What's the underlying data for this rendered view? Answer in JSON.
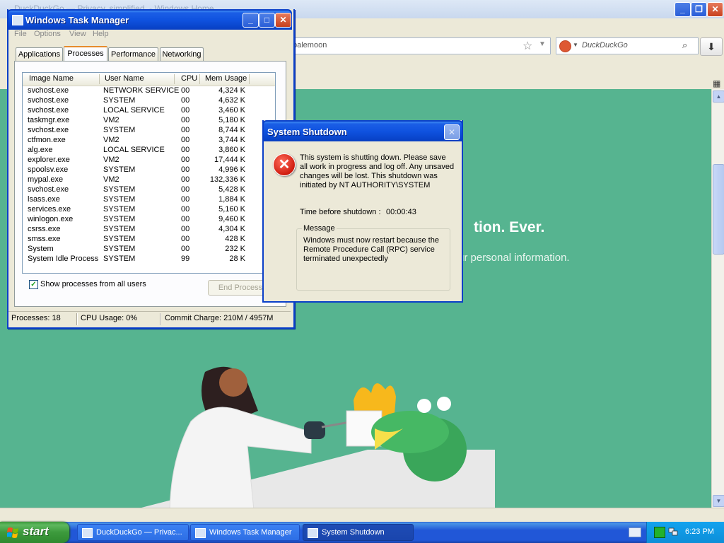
{
  "browser": {
    "title": "DuckDuckGo — Privacy, simplified. - Windows Home",
    "url_value": "palemoon",
    "search_placeholder": "DuckDuckGo",
    "hero_heading": "tion. Ever.",
    "hero_subtext": "ur personal information."
  },
  "taskmgr": {
    "title": "Windows Task Manager",
    "menu": [
      "File",
      "Options",
      "View",
      "Help"
    ],
    "tabs": [
      "Applications",
      "Processes",
      "Performance",
      "Networking"
    ],
    "active_tab": "Processes",
    "columns": [
      "Image Name",
      "User Name",
      "CPU",
      "Mem Usage"
    ],
    "processes": [
      [
        "svchost.exe",
        "NETWORK SERVICE",
        "00",
        "4,324 K"
      ],
      [
        "svchost.exe",
        "SYSTEM",
        "00",
        "4,632 K"
      ],
      [
        "svchost.exe",
        "LOCAL SERVICE",
        "00",
        "3,460 K"
      ],
      [
        "taskmgr.exe",
        "VM2",
        "00",
        "5,180 K"
      ],
      [
        "svchost.exe",
        "SYSTEM",
        "00",
        "8,744 K"
      ],
      [
        "ctfmon.exe",
        "VM2",
        "00",
        "3,744 K"
      ],
      [
        "alg.exe",
        "LOCAL SERVICE",
        "00",
        "3,860 K"
      ],
      [
        "explorer.exe",
        "VM2",
        "00",
        "17,444 K"
      ],
      [
        "spoolsv.exe",
        "SYSTEM",
        "00",
        "4,996 K"
      ],
      [
        "mypal.exe",
        "VM2",
        "00",
        "132,336 K"
      ],
      [
        "svchost.exe",
        "SYSTEM",
        "00",
        "5,428 K"
      ],
      [
        "lsass.exe",
        "SYSTEM",
        "00",
        "1,884 K"
      ],
      [
        "services.exe",
        "SYSTEM",
        "00",
        "5,160 K"
      ],
      [
        "winlogon.exe",
        "SYSTEM",
        "00",
        "9,460 K"
      ],
      [
        "csrss.exe",
        "SYSTEM",
        "00",
        "4,304 K"
      ],
      [
        "smss.exe",
        "SYSTEM",
        "00",
        "428 K"
      ],
      [
        "System",
        "SYSTEM",
        "00",
        "232 K"
      ],
      [
        "System Idle Process",
        "SYSTEM",
        "99",
        "28 K"
      ]
    ],
    "show_all_label": "Show processes from all users",
    "show_all_checked": true,
    "end_process_label": "End Process",
    "status": {
      "processes": "Processes: 18",
      "cpu": "CPU Usage: 0%",
      "commit": "Commit Charge: 210M / 4957M"
    }
  },
  "shutdown": {
    "title": "System Shutdown",
    "message": "This system is shutting down. Please save all work in progress and log off. Any unsaved changes will be lost. This shutdown was initiated by NT AUTHORITY\\SYSTEM",
    "time_label": "Time before shutdown :",
    "time_value": "00:00:43",
    "group_label": "Message",
    "group_text": "Windows must now restart because the Remote Procedure Call (RPC) service terminated unexpectedly"
  },
  "taskbar": {
    "start_label": "start",
    "buttons": [
      "DuckDuckGo — Privac...",
      "Windows Task Manager",
      "System Shutdown"
    ],
    "active_button": "System Shutdown",
    "clock": "6:23 PM"
  },
  "colors": {
    "page_green": "#56b490",
    "xp_blue": "#0f52df",
    "start_green": "#3c9a3c",
    "error_red": "#d01d10"
  }
}
